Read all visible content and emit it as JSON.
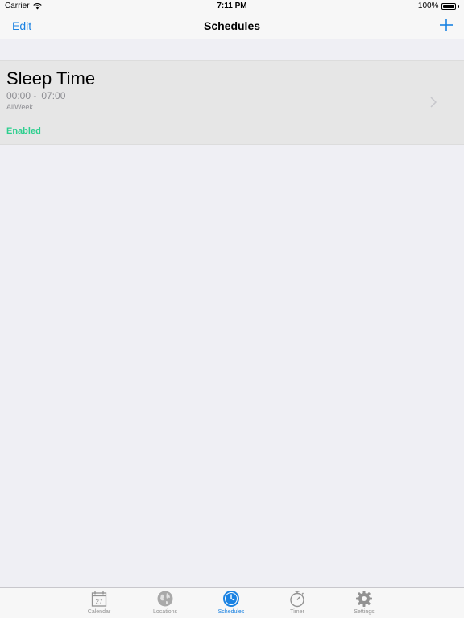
{
  "status_bar": {
    "carrier": "Carrier",
    "time": "7:11 PM",
    "battery": "100%",
    "battery_level": 1.0
  },
  "nav_bar": {
    "edit_label": "Edit",
    "title": "Schedules",
    "add_icon": "plus-icon"
  },
  "schedules": [
    {
      "title": "Sleep Time",
      "start": "00:00 -",
      "end": "07:00",
      "days": "AllWeek",
      "status": "Enabled"
    }
  ],
  "tabs": [
    {
      "label": "Calendar",
      "icon": "calendar-icon",
      "calendar_day": "27",
      "active": false
    },
    {
      "label": "Locations",
      "icon": "globe-icon",
      "active": false
    },
    {
      "label": "Schedules",
      "icon": "clock-icon",
      "active": true
    },
    {
      "label": "Timer",
      "icon": "stopwatch-icon",
      "active": false
    },
    {
      "label": "Settings",
      "icon": "gear-icon",
      "active": false
    }
  ],
  "colors": {
    "accent": "#1a82e2",
    "enabled": "#2ecf8f",
    "inactive_tab": "#929292",
    "background": "#efeff4"
  }
}
